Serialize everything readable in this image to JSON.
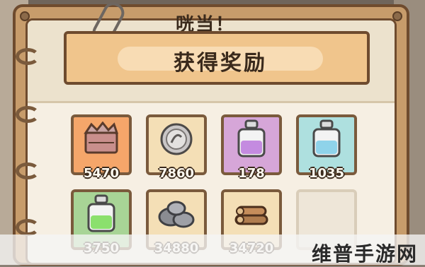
{
  "header": {
    "title": "咣当！"
  },
  "banner": {
    "label": "获得奖励"
  },
  "rewards": [
    {
      "name": "treasure-crate",
      "count": "5470",
      "bg": "#f5a66a"
    },
    {
      "name": "silver-coin",
      "count": "7860",
      "bg": "#f4dfb6"
    },
    {
      "name": "purple-potion",
      "count": "178",
      "bg": "#d6a6d8"
    },
    {
      "name": "blue-potion",
      "count": "1035",
      "bg": "#aee0df"
    },
    {
      "name": "green-potion",
      "count": "3750",
      "bg": "#a8d496"
    },
    {
      "name": "stone-pile",
      "count": "34880",
      "bg": "#f4dfb6"
    },
    {
      "name": "wood-logs",
      "count": "34720",
      "bg": "#f4dfb6"
    },
    {
      "name": "empty-slot",
      "count": "",
      "bg": "#eee6d8"
    }
  ],
  "watermark": "维普手游网"
}
